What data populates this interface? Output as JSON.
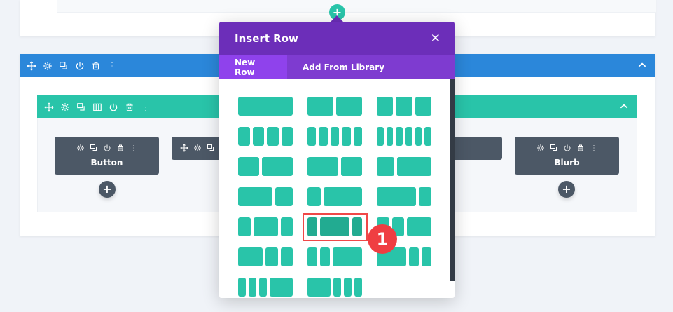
{
  "popup": {
    "title": "Insert Row",
    "close_icon": "close-icon",
    "tabs": [
      {
        "label": "New Row",
        "active": true
      },
      {
        "label": "Add From Library",
        "active": false
      }
    ],
    "selected_layout": "1/5 + 3/5 + 1/5"
  },
  "modules": [
    {
      "label": "Button"
    },
    {
      "label": "Blurb"
    }
  ],
  "annotation": {
    "step": "1"
  },
  "colors": {
    "section": "#2b87da",
    "row": "#29c4a9",
    "popup": "#6c2eb9",
    "highlight": "#f04848"
  }
}
